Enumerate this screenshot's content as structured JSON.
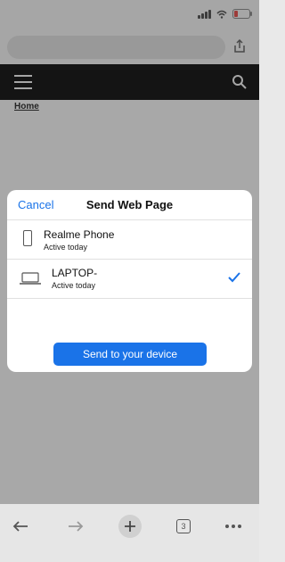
{
  "browser": {
    "home_link": "Home"
  },
  "sheet": {
    "cancel_label": "Cancel",
    "title": "Send Web Page",
    "devices": [
      {
        "name": "Realme Phone",
        "status": "Active today",
        "icon": "phone-icon",
        "selected": false
      },
      {
        "name": "LAPTOP-",
        "status": "Active today",
        "icon": "laptop-icon",
        "selected": true
      }
    ],
    "send_button_label": "Send to your device"
  },
  "toolbar": {
    "tab_count": "3"
  },
  "colors": {
    "accent": "#1a73e8",
    "header_bg": "#1d1d1d"
  }
}
